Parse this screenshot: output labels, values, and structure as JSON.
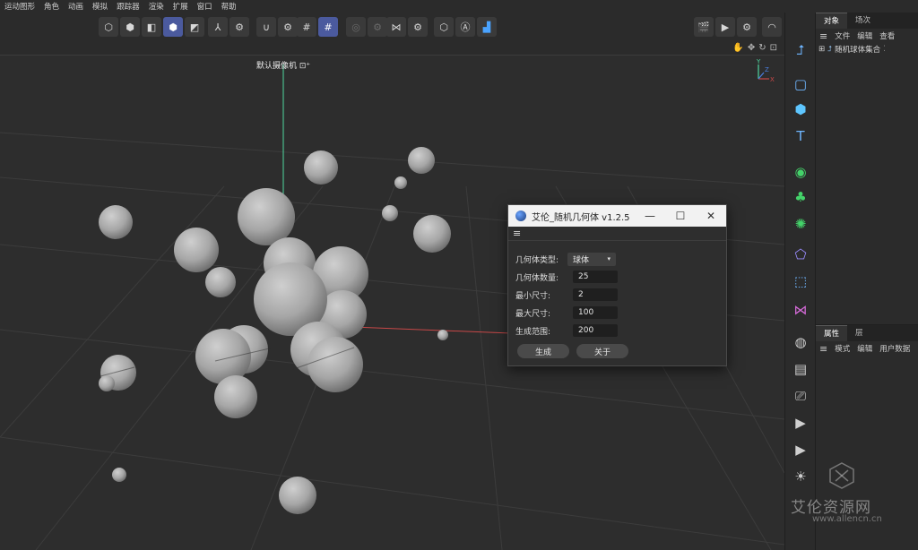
{
  "menu": [
    "运动图形",
    "角色",
    "动画",
    "模拟",
    "跟踪器",
    "渲染",
    "扩展",
    "窗口",
    "帮助"
  ],
  "viewport": {
    "camera_label": "默认摄像机 ⊡⁺",
    "axis_y": "Y",
    "axis_z": "Z",
    "axis_x": "X"
  },
  "object_manager": {
    "tabs": [
      "对象",
      "场次"
    ],
    "menu": [
      "文件",
      "编辑",
      "查看"
    ],
    "items": [
      {
        "label": "随机球体集合"
      }
    ]
  },
  "attribute_manager": {
    "tabs": [
      "属性",
      "层"
    ],
    "menu": [
      "模式",
      "编辑",
      "用户数据"
    ]
  },
  "dialog": {
    "title": "艾伦_随机几何体 v1.2.5",
    "minimize": "—",
    "maximize": "☐",
    "close": "✕",
    "menu_icon": "≡",
    "fields": {
      "type": {
        "label": "几何体类型:",
        "value": "球体"
      },
      "count": {
        "label": "几何体数量:",
        "value": "25"
      },
      "min_size": {
        "label": "最小尺寸:",
        "value": "2"
      },
      "max_size": {
        "label": "最大尺寸:",
        "value": "100"
      },
      "range": {
        "label": "生成范围:",
        "value": "200"
      }
    },
    "generate_button": "生成",
    "about_button": "关于"
  },
  "watermark": {
    "text": "艾伦资源网",
    "url": "www.allencn.cn"
  },
  "colors": {
    "accent": "#4b5a9e",
    "y_axis": "#4fd6a0",
    "x_axis": "#c84848",
    "palette_green": "#44d36a",
    "palette_cyan": "#5ec6ff",
    "palette_pink": "#d56ad8"
  }
}
